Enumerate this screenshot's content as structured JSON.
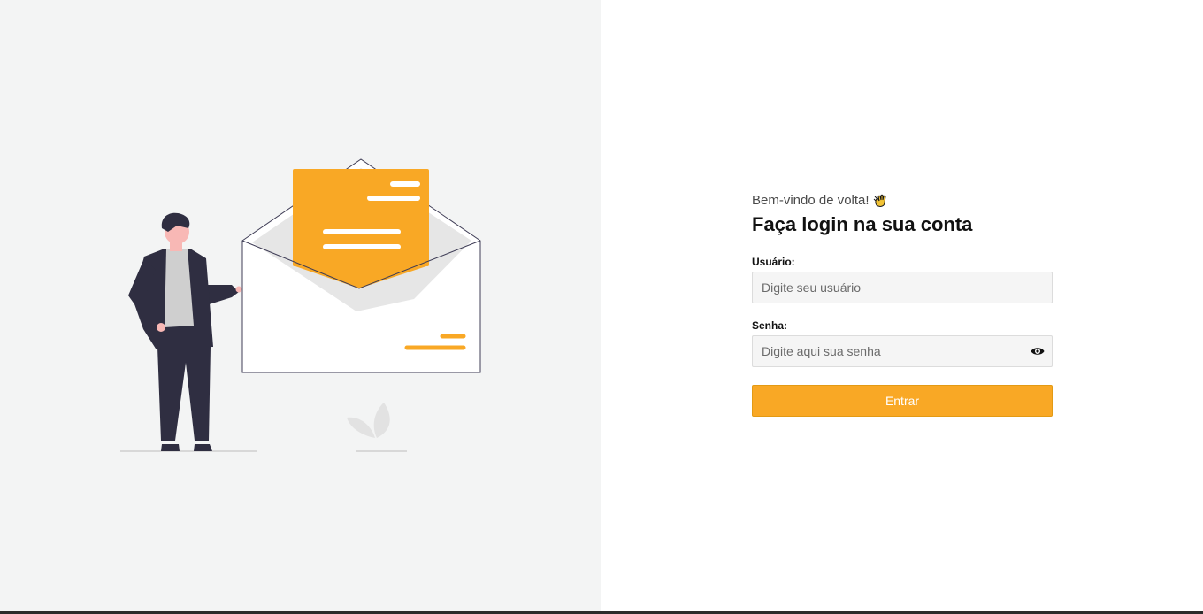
{
  "login": {
    "greeting": "Bem-vindo de volta!",
    "greeting_icon": "waving-hand-icon",
    "title": "Faça login na sua conta",
    "username_label": "Usuário:",
    "username_placeholder": "Digite seu usuário",
    "password_label": "Senha:",
    "password_placeholder": "Digite aqui sua senha",
    "password_toggle_icon": "eye-icon",
    "submit_label": "Entrar"
  },
  "illustration": {
    "subject": "person-with-envelope-illustration",
    "accent_color": "#f9a825"
  },
  "colors": {
    "left_panel_bg": "#f3f4f4",
    "accent": "#f9a825",
    "figure_dark": "#2f2e41"
  }
}
